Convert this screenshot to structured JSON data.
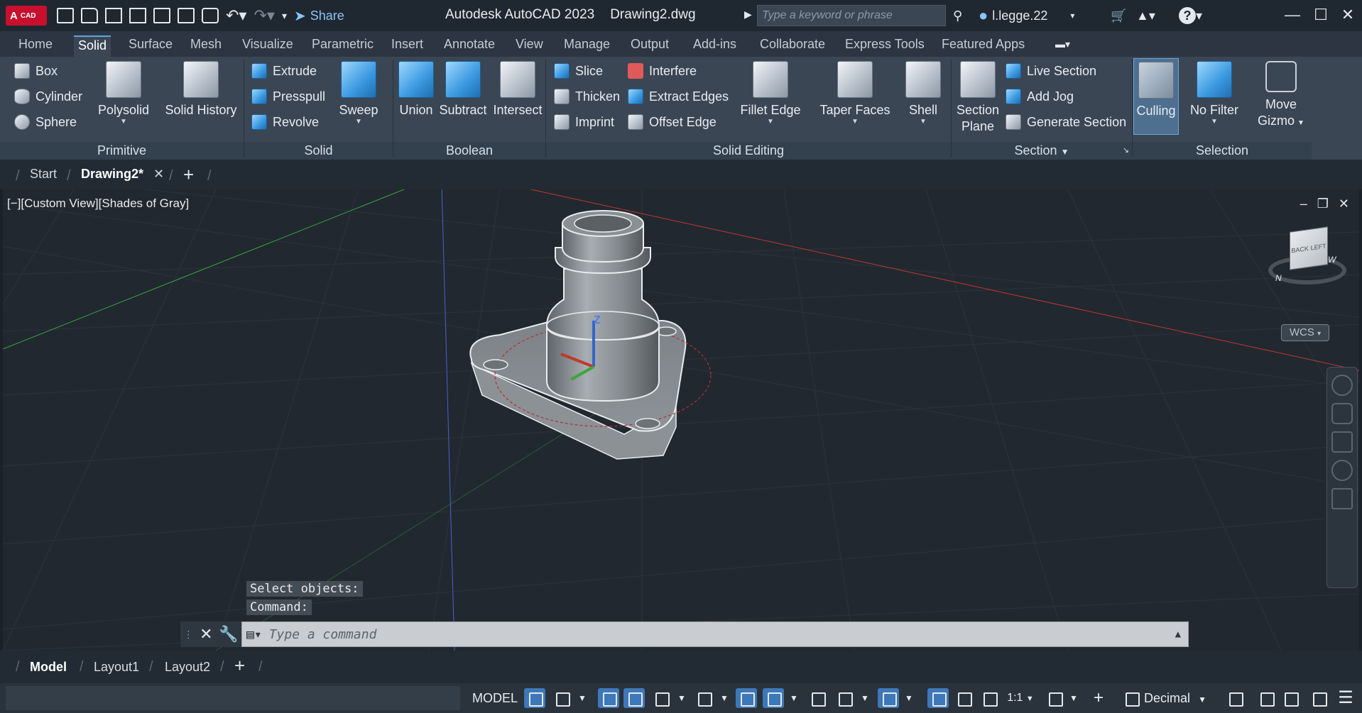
{
  "titlebar": {
    "logo_main": "A",
    "logo_sub": "CAD",
    "share_label": "Share",
    "app_title": "Autodesk AutoCAD 2023",
    "file_name": "Drawing2.dwg",
    "search_placeholder": "Type a keyword or phrase",
    "user_name": "l.legge.22"
  },
  "ribbon_tabs": [
    "Home",
    "Solid",
    "Surface",
    "Mesh",
    "Visualize",
    "Parametric",
    "Insert",
    "Annotate",
    "View",
    "Manage",
    "Output",
    "Add-ins",
    "Collaborate",
    "Express Tools",
    "Featured Apps"
  ],
  "ribbon_active_tab": "Solid",
  "ribbon": {
    "primitive": {
      "title": "Primitive",
      "box": "Box",
      "cylinder": "Cylinder",
      "sphere": "Sphere",
      "polysolid": "Polysolid",
      "solid_history": "Solid History"
    },
    "solid": {
      "title": "Solid",
      "extrude": "Extrude",
      "presspull": "Presspull",
      "revolve": "Revolve",
      "sweep": "Sweep"
    },
    "boolean": {
      "title": "Boolean",
      "union": "Union",
      "subtract": "Subtract",
      "intersect": "Intersect"
    },
    "solid_editing": {
      "title": "Solid Editing",
      "slice": "Slice",
      "thicken": "Thicken",
      "imprint": "Imprint",
      "interfere": "Interfere",
      "extract_edges": "Extract Edges",
      "offset_edge": "Offset Edge",
      "fillet_edge": "Fillet Edge",
      "taper_faces": "Taper Faces",
      "shell": "Shell"
    },
    "section": {
      "title": "Section",
      "section_plane_1": "Section",
      "section_plane_2": "Plane",
      "live_section": "Live Section",
      "add_jog": "Add Jog",
      "generate_section": "Generate Section"
    },
    "selection": {
      "title": "Selection",
      "culling": "Culling",
      "no_filter": "No Filter",
      "move_gizmo_1": "Move",
      "move_gizmo_2": "Gizmo"
    }
  },
  "doc_tabs": {
    "start": "Start",
    "drawing": "Drawing2*"
  },
  "viewport": {
    "label": "[−][Custom View][Shades of Gray]",
    "viewcube_back": "BACK",
    "viewcube_left": "LEFT",
    "compass_n": "N",
    "compass_w": "W",
    "wcs": "WCS",
    "ucs_z": "Z"
  },
  "command": {
    "history": [
      "Select objects:",
      "Command:"
    ],
    "placeholder": "Type a command"
  },
  "layout_tabs": [
    "Model",
    "Layout1",
    "Layout2"
  ],
  "statusbar": {
    "model": "MODEL",
    "scale": "1:1",
    "units": "Decimal"
  },
  "colors": {
    "accent": "#3d78b8",
    "ribbon": "#3b4654",
    "viewport": "#212830",
    "x_axis": "#c0392b",
    "y_axis": "#37a83b",
    "z_axis": "#3366cc"
  }
}
